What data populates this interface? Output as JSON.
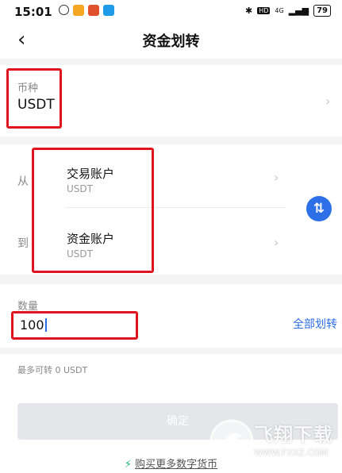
{
  "status_bar": {
    "time": "15:01",
    "network": "4G",
    "battery": "79"
  },
  "header": {
    "title": "资金划转"
  },
  "currency": {
    "label": "币种",
    "value": "USDT"
  },
  "transfer": {
    "from_label": "从",
    "to_label": "到",
    "from_account": {
      "name": "交易账户",
      "currency": "USDT"
    },
    "to_account": {
      "name": "资金账户",
      "currency": "USDT"
    }
  },
  "amount": {
    "label": "数量",
    "value": "100",
    "all_label": "全部划转"
  },
  "max_transfer": "最多可转 0 USDT",
  "confirm_label": "确定",
  "buy_more_label": "购买更多数字货币",
  "watermark": {
    "brand": "飞翔下载",
    "url": "WWW.FXXZ.COM"
  },
  "colors": {
    "accent": "#2c6fe6",
    "highlight_box": "#e0141e",
    "link_green": "#1fb56f"
  }
}
